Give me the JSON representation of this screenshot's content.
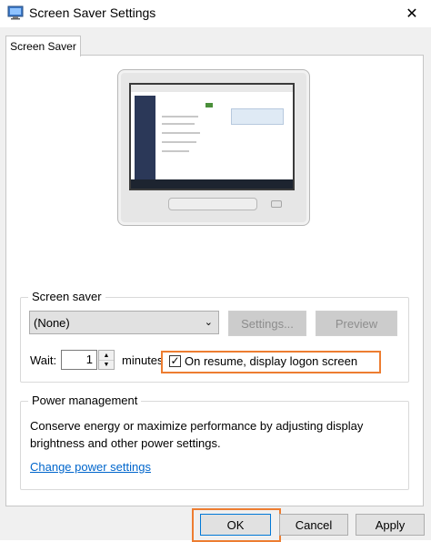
{
  "window": {
    "title": "Screen Saver Settings",
    "close_glyph": "✕",
    "app_icon": "screen-saver-icon"
  },
  "tabs": [
    {
      "label": "Screen Saver",
      "selected": true
    }
  ],
  "screen_saver": {
    "group_label": "Screen saver",
    "selected": "(None)",
    "settings_label": "Settings...",
    "preview_label": "Preview",
    "wait_label": "Wait:",
    "wait_value": "1",
    "minutes_label": "minutes",
    "logon_checked": true,
    "logon_label": "On resume, display logon screen"
  },
  "power": {
    "group_label": "Power management",
    "description": "Conserve energy or maximize performance by adjusting display brightness and other power settings.",
    "link_label": "Change power settings"
  },
  "footer": {
    "ok_label": "OK",
    "cancel_label": "Cancel",
    "apply_label": "Apply"
  },
  "colors": {
    "highlight": "#ed7d31",
    "link": "#0066cc"
  }
}
